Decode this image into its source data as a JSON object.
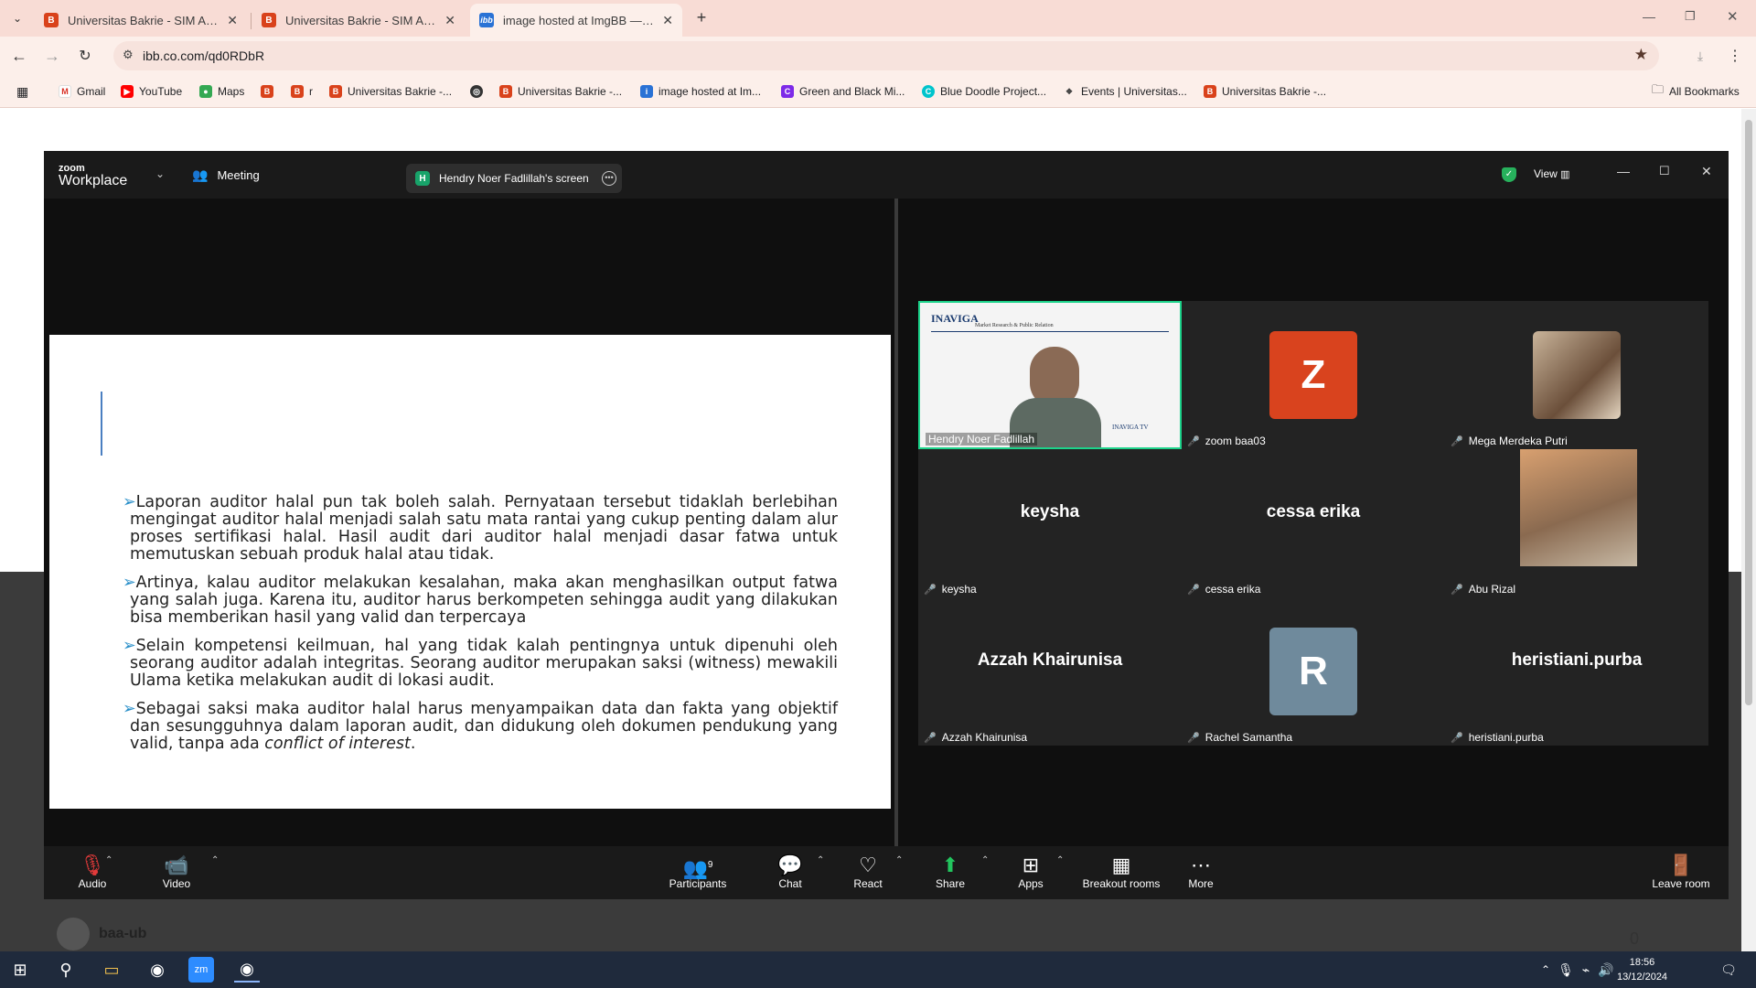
{
  "browser": {
    "tabs": [
      {
        "title": "Universitas Bakrie - SIM Akaden",
        "active": false
      },
      {
        "title": "Universitas Bakrie - SIM Akaden",
        "active": false
      },
      {
        "title": "image hosted at ImgBB — Imgl",
        "active": true
      }
    ],
    "url": "ibb.co.com/qd0RDbR",
    "bookmarks": [
      "Gmail",
      "YouTube",
      "Maps",
      "r",
      "Universitas Bakrie -...",
      "Universitas Bakrie -...",
      "image hosted at Im...",
      "Green and Black Mi...",
      "Blue Doodle Project...",
      "Events | Universitas...",
      "Universitas Bakrie -..."
    ],
    "all_bookmarks": "All Bookmarks"
  },
  "page": {
    "user_name": "baa-ub",
    "count": "0"
  },
  "zoom": {
    "logo_top": "zoom",
    "logo_bottom": "Workplace",
    "meeting_label": "Meeting",
    "share_label": "Hendry Noer Fadlillah's screen",
    "share_badge": "H",
    "view_label": "View",
    "slide": {
      "bullets": [
        "Laporan auditor halal pun tak boleh salah. Pernyataan tersebut tidaklah berlebihan mengingat auditor halal menjadi salah satu mata rantai yang cukup penting dalam alur proses sertifikasi halal. Hasil audit dari auditor halal menjadi dasar fatwa untuk memutuskan sebuah produk halal atau tidak.",
        "Artinya, kalau auditor melakukan kesalahan, maka akan menghasilkan output fatwa yang salah juga. Karena itu, auditor harus berkompeten sehingga audit yang dilakukan bisa memberikan hasil yang valid dan terpercaya",
        "Selain kompetensi keilmuan, hal yang tidak kalah pentingnya untuk dipenuhi oleh seorang auditor adalah integritas. Seorang auditor merupakan saksi (witness) mewakili Ulama ketika melakukan audit di lokasi audit."
      ],
      "last_bullet_main": "Sebagai saksi maka auditor halal harus menyampaikan data dan fakta yang objektif dan sesungguhnya dalam laporan audit, dan didukung oleh dokumen pendukung yang valid, tanpa ada ",
      "last_bullet_italic": "conflict of interest",
      "last_bullet_end": "."
    },
    "speaker": {
      "name": "Hendry Noer Fadlillah",
      "banner": "INAVIGA",
      "banner_sub": "Market Research & Public Relation",
      "tv": "INAVIGA TV"
    },
    "participants": [
      {
        "name": "zoom baa03",
        "avatar_letter": "Z",
        "color": "#d9431e"
      },
      {
        "name": "Mega Merdeka Putri"
      },
      {
        "name": "keysha",
        "display": "keysha"
      },
      {
        "name": "cessa erika",
        "display": "cessa erika"
      },
      {
        "name": "Abu Rizal"
      },
      {
        "name": "Azzah Khairunisa",
        "display": "Azzah Khairunisa"
      },
      {
        "name": "Rachel Samantha",
        "avatar_letter": "R",
        "color": "#6f8a9c"
      },
      {
        "name": "heristiani.purba",
        "display": "heristiani.purba"
      }
    ],
    "toolbar": {
      "audio": "Audio",
      "video": "Video",
      "participants": "Participants",
      "participants_count": "9",
      "chat": "Chat",
      "react": "React",
      "share": "Share",
      "apps": "Apps",
      "breakout": "Breakout rooms",
      "more": "More",
      "leave": "Leave room"
    }
  },
  "taskbar": {
    "time": "18:56",
    "date": "13/12/2024"
  }
}
